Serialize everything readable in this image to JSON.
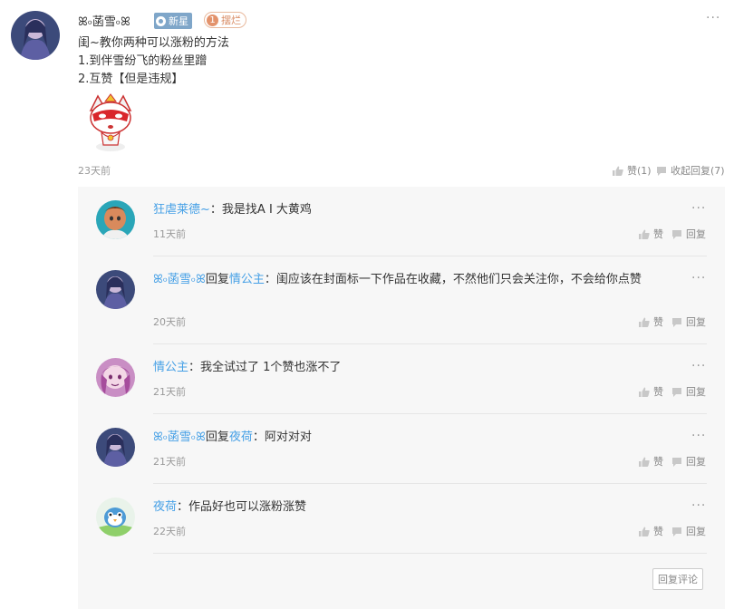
{
  "post": {
    "author": "ꕤ৹菡雪৹ꕤ",
    "badge_new": "新星",
    "level": "1",
    "badge_level_label": "摆烂",
    "lines": [
      "闺~教你两种可以涨粉的方法",
      "1.到伴雪纷飞的粉丝里蹭",
      "2.互赞【但是违规】"
    ],
    "time": "23天前",
    "like_label": "赞(1)",
    "collapse_label": "收起回复(7)",
    "more": "···"
  },
  "comments": [
    {
      "name": "狂虐莱德~",
      "sep": "：",
      "reply_word": "",
      "reply_to": "",
      "text": "我是找A I 大黄鸡",
      "time": "11天前",
      "like": "赞",
      "reply": "回复",
      "more": "···"
    },
    {
      "name": "ꕤ৹菡雪৹ꕤ",
      "sep": "：",
      "reply_word": "回复",
      "reply_to": "情公主",
      "text": "闺应该在封面标一下作品在收藏，不然他们只会关注你，不会给你点赞",
      "time": "20天前",
      "like": "赞",
      "reply": "回复",
      "more": "···"
    },
    {
      "name": "情公主",
      "sep": "：",
      "reply_word": "",
      "reply_to": "",
      "text": "我全试过了 1个赞也涨不了",
      "time": "21天前",
      "like": "赞",
      "reply": "回复",
      "more": "···"
    },
    {
      "name": "ꕤ৹菡雪৹ꕤ",
      "sep": "：",
      "reply_word": "回复",
      "reply_to": "夜荷",
      "text": "阿对对对",
      "time": "21天前",
      "like": "赞",
      "reply": "回复",
      "more": "···"
    },
    {
      "name": "夜荷",
      "sep": "：",
      "reply_word": "",
      "reply_to": "",
      "text": "作品好也可以涨粉涨赞",
      "time": "22天前",
      "like": "赞",
      "reply": "回复",
      "more": "···"
    }
  ],
  "reply_comment_button": "回复评论"
}
